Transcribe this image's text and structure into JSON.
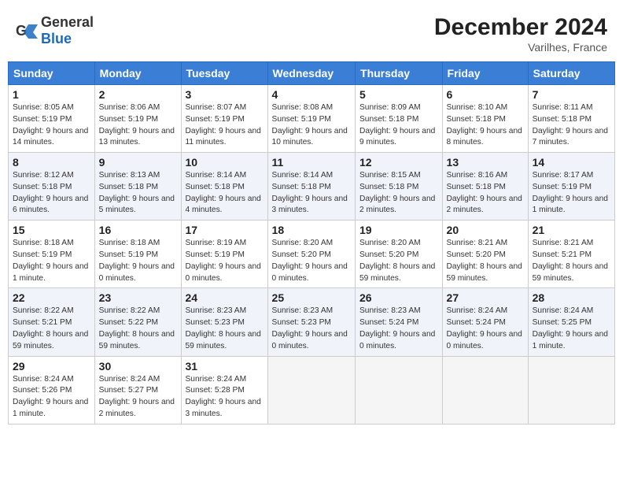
{
  "header": {
    "logo_general": "General",
    "logo_blue": "Blue",
    "month_year": "December 2024",
    "location": "Varilhes, France"
  },
  "days_of_week": [
    "Sunday",
    "Monday",
    "Tuesday",
    "Wednesday",
    "Thursday",
    "Friday",
    "Saturday"
  ],
  "weeks": [
    [
      {
        "day": "1",
        "sunrise": "Sunrise: 8:05 AM",
        "sunset": "Sunset: 5:19 PM",
        "daylight": "Daylight: 9 hours and 14 minutes."
      },
      {
        "day": "2",
        "sunrise": "Sunrise: 8:06 AM",
        "sunset": "Sunset: 5:19 PM",
        "daylight": "Daylight: 9 hours and 13 minutes."
      },
      {
        "day": "3",
        "sunrise": "Sunrise: 8:07 AM",
        "sunset": "Sunset: 5:19 PM",
        "daylight": "Daylight: 9 hours and 11 minutes."
      },
      {
        "day": "4",
        "sunrise": "Sunrise: 8:08 AM",
        "sunset": "Sunset: 5:19 PM",
        "daylight": "Daylight: 9 hours and 10 minutes."
      },
      {
        "day": "5",
        "sunrise": "Sunrise: 8:09 AM",
        "sunset": "Sunset: 5:18 PM",
        "daylight": "Daylight: 9 hours and 9 minutes."
      },
      {
        "day": "6",
        "sunrise": "Sunrise: 8:10 AM",
        "sunset": "Sunset: 5:18 PM",
        "daylight": "Daylight: 9 hours and 8 minutes."
      },
      {
        "day": "7",
        "sunrise": "Sunrise: 8:11 AM",
        "sunset": "Sunset: 5:18 PM",
        "daylight": "Daylight: 9 hours and 7 minutes."
      }
    ],
    [
      {
        "day": "8",
        "sunrise": "Sunrise: 8:12 AM",
        "sunset": "Sunset: 5:18 PM",
        "daylight": "Daylight: 9 hours and 6 minutes."
      },
      {
        "day": "9",
        "sunrise": "Sunrise: 8:13 AM",
        "sunset": "Sunset: 5:18 PM",
        "daylight": "Daylight: 9 hours and 5 minutes."
      },
      {
        "day": "10",
        "sunrise": "Sunrise: 8:14 AM",
        "sunset": "Sunset: 5:18 PM",
        "daylight": "Daylight: 9 hours and 4 minutes."
      },
      {
        "day": "11",
        "sunrise": "Sunrise: 8:14 AM",
        "sunset": "Sunset: 5:18 PM",
        "daylight": "Daylight: 9 hours and 3 minutes."
      },
      {
        "day": "12",
        "sunrise": "Sunrise: 8:15 AM",
        "sunset": "Sunset: 5:18 PM",
        "daylight": "Daylight: 9 hours and 2 minutes."
      },
      {
        "day": "13",
        "sunrise": "Sunrise: 8:16 AM",
        "sunset": "Sunset: 5:18 PM",
        "daylight": "Daylight: 9 hours and 2 minutes."
      },
      {
        "day": "14",
        "sunrise": "Sunrise: 8:17 AM",
        "sunset": "Sunset: 5:19 PM",
        "daylight": "Daylight: 9 hours and 1 minute."
      }
    ],
    [
      {
        "day": "15",
        "sunrise": "Sunrise: 8:18 AM",
        "sunset": "Sunset: 5:19 PM",
        "daylight": "Daylight: 9 hours and 1 minute."
      },
      {
        "day": "16",
        "sunrise": "Sunrise: 8:18 AM",
        "sunset": "Sunset: 5:19 PM",
        "daylight": "Daylight: 9 hours and 0 minutes."
      },
      {
        "day": "17",
        "sunrise": "Sunrise: 8:19 AM",
        "sunset": "Sunset: 5:19 PM",
        "daylight": "Daylight: 9 hours and 0 minutes."
      },
      {
        "day": "18",
        "sunrise": "Sunrise: 8:20 AM",
        "sunset": "Sunset: 5:20 PM",
        "daylight": "Daylight: 9 hours and 0 minutes."
      },
      {
        "day": "19",
        "sunrise": "Sunrise: 8:20 AM",
        "sunset": "Sunset: 5:20 PM",
        "daylight": "Daylight: 8 hours and 59 minutes."
      },
      {
        "day": "20",
        "sunrise": "Sunrise: 8:21 AM",
        "sunset": "Sunset: 5:20 PM",
        "daylight": "Daylight: 8 hours and 59 minutes."
      },
      {
        "day": "21",
        "sunrise": "Sunrise: 8:21 AM",
        "sunset": "Sunset: 5:21 PM",
        "daylight": "Daylight: 8 hours and 59 minutes."
      }
    ],
    [
      {
        "day": "22",
        "sunrise": "Sunrise: 8:22 AM",
        "sunset": "Sunset: 5:21 PM",
        "daylight": "Daylight: 8 hours and 59 minutes."
      },
      {
        "day": "23",
        "sunrise": "Sunrise: 8:22 AM",
        "sunset": "Sunset: 5:22 PM",
        "daylight": "Daylight: 8 hours and 59 minutes."
      },
      {
        "day": "24",
        "sunrise": "Sunrise: 8:23 AM",
        "sunset": "Sunset: 5:23 PM",
        "daylight": "Daylight: 8 hours and 59 minutes."
      },
      {
        "day": "25",
        "sunrise": "Sunrise: 8:23 AM",
        "sunset": "Sunset: 5:23 PM",
        "daylight": "Daylight: 9 hours and 0 minutes."
      },
      {
        "day": "26",
        "sunrise": "Sunrise: 8:23 AM",
        "sunset": "Sunset: 5:24 PM",
        "daylight": "Daylight: 9 hours and 0 minutes."
      },
      {
        "day": "27",
        "sunrise": "Sunrise: 8:24 AM",
        "sunset": "Sunset: 5:24 PM",
        "daylight": "Daylight: 9 hours and 0 minutes."
      },
      {
        "day": "28",
        "sunrise": "Sunrise: 8:24 AM",
        "sunset": "Sunset: 5:25 PM",
        "daylight": "Daylight: 9 hours and 1 minute."
      }
    ],
    [
      {
        "day": "29",
        "sunrise": "Sunrise: 8:24 AM",
        "sunset": "Sunset: 5:26 PM",
        "daylight": "Daylight: 9 hours and 1 minute."
      },
      {
        "day": "30",
        "sunrise": "Sunrise: 8:24 AM",
        "sunset": "Sunset: 5:27 PM",
        "daylight": "Daylight: 9 hours and 2 minutes."
      },
      {
        "day": "31",
        "sunrise": "Sunrise: 8:24 AM",
        "sunset": "Sunset: 5:28 PM",
        "daylight": "Daylight: 9 hours and 3 minutes."
      },
      null,
      null,
      null,
      null
    ]
  ]
}
